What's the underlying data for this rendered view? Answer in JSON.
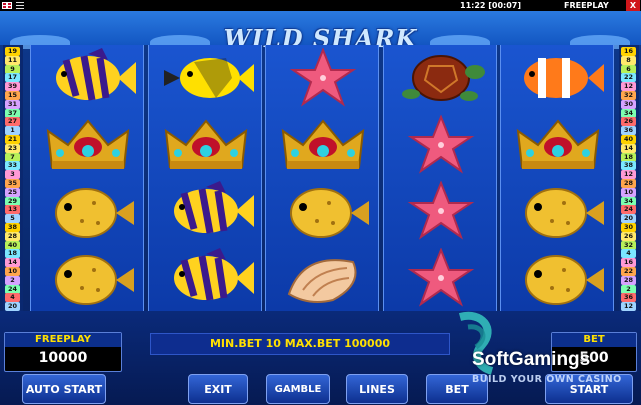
{
  "topbar": {
    "clock": "11:22 [00:07]",
    "mode": "FREEPLAY",
    "close_label": "X"
  },
  "game": {
    "title": "WILD SHARK"
  },
  "paylines": {
    "left": [
      "19",
      "11",
      "9",
      "17",
      "39",
      "15",
      "31",
      "37",
      "27",
      "1",
      "21",
      "23",
      "7",
      "33",
      "3",
      "35",
      "25",
      "29",
      "13",
      "5",
      "38",
      "28",
      "40",
      "18",
      "14",
      "10",
      "2",
      "24",
      "4",
      "20"
    ],
    "right": [
      "16",
      "8",
      "6",
      "22",
      "12",
      "32",
      "30",
      "34",
      "26",
      "36",
      "40",
      "14",
      "18",
      "38",
      "12",
      "28",
      "10",
      "34",
      "24",
      "20",
      "30",
      "26",
      "32",
      "4",
      "16",
      "22",
      "28",
      "2",
      "36",
      "12"
    ],
    "colors": [
      "#ffd200",
      "#ffe96b",
      "#b7f05a",
      "#7be7ff",
      "#ff9ad5",
      "#ffa64d",
      "#d6a3ff",
      "#7dffb0",
      "#ff6b6b",
      "#9fd3ff"
    ]
  },
  "reels": [
    [
      "angelfish",
      "crown",
      "pufferfish",
      "pufferfish"
    ],
    [
      "yellow-tang",
      "crown",
      "angelfish",
      "angelfish"
    ],
    [
      "starfish",
      "crown",
      "pufferfish",
      "conch-shell"
    ],
    [
      "turtle",
      "starfish",
      "starfish",
      "starfish"
    ],
    [
      "clownfish",
      "crown",
      "pufferfish",
      "pufferfish"
    ]
  ],
  "freeplay": {
    "label": "FREEPLAY",
    "value": "10000"
  },
  "bet": {
    "label": "BET",
    "value": "500"
  },
  "message": "MIN.BET 10 MAX.BET 100000",
  "buttons": {
    "auto": "AUTO START",
    "exit": "EXIT",
    "gamble": "GAMBLE",
    "lines": "LINES",
    "bet": "BET",
    "start": "START"
  },
  "watermark": {
    "brand": "SoftGamings",
    "tagline": "BUILD YOUR OWN CASINO"
  }
}
